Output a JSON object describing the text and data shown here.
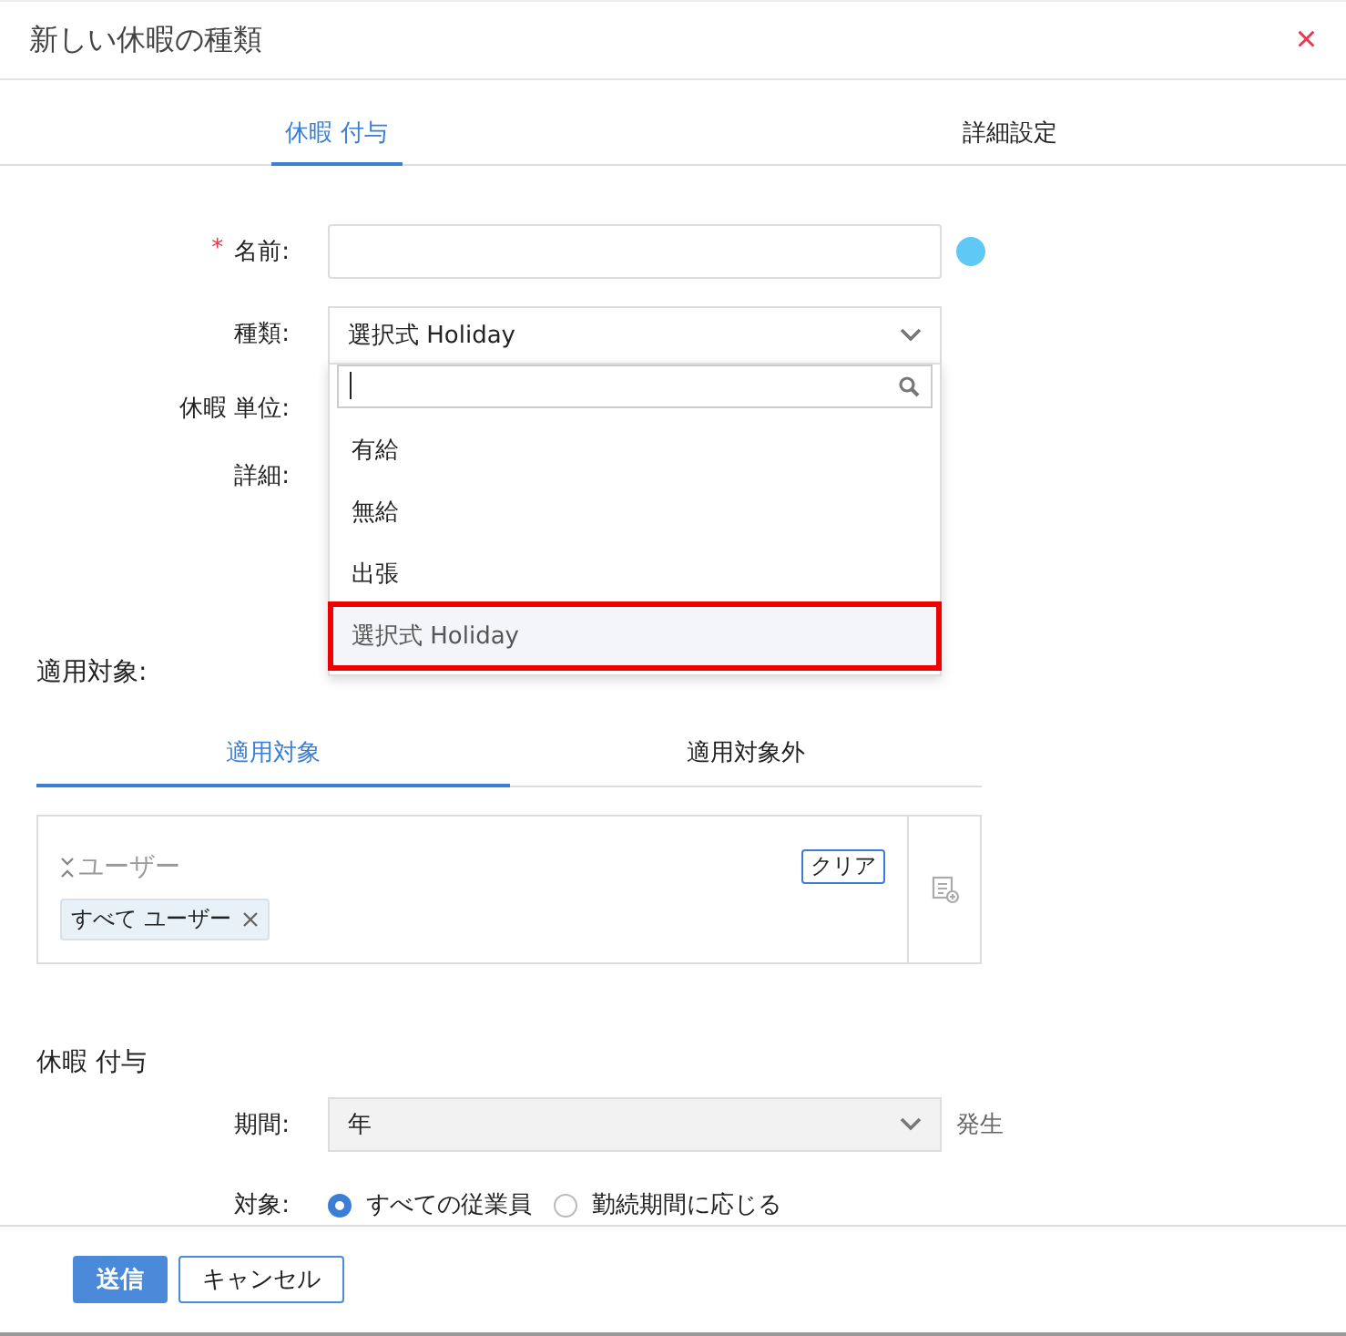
{
  "dialog": {
    "title": "新しい休暇の種類",
    "close": "×"
  },
  "tabs": [
    {
      "label": "休暇 付与",
      "selected": true
    },
    {
      "label": "詳細設定",
      "selected": false
    }
  ],
  "required_mark": "*",
  "fields": [
    {
      "kind": "text",
      "label": "名前:",
      "required": true
    },
    {
      "kind": "select",
      "label": "種類:",
      "required": false,
      "value": "選択式 Holiday",
      "expanded": true,
      "options": [
        {
          "label": "有給",
          "selected": false
        },
        {
          "label": "無給",
          "selected": false
        },
        {
          "label": "出張",
          "selected": false
        },
        {
          "label": "選択式 Holiday",
          "selected": true
        }
      ]
    },
    {
      "kind": "label",
      "label": "休暇 単位:",
      "required": false
    },
    {
      "kind": "label",
      "label": "詳細:",
      "required": false
    }
  ],
  "applies_to": {
    "heading": "適用対象:",
    "tabs": [
      {
        "label": "適用対象",
        "selected": true
      },
      {
        "label": "適用対象外",
        "selected": false
      }
    ],
    "placeholder": "ユーザー",
    "clear": "クリア",
    "chips": [
      {
        "label": "すべて ユーザー"
      }
    ]
  },
  "grant": {
    "heading": "休暇 付与",
    "period": {
      "label": "期間:",
      "value": "年",
      "suffix": "発生"
    },
    "target": {
      "label": "対象:",
      "options": [
        {
          "label": "すべての従業員",
          "selected": true
        },
        {
          "label": "勤続期間に応じる",
          "selected": false
        }
      ]
    }
  },
  "buttons": [
    {
      "label": "送信",
      "kind": "primary"
    },
    {
      "label": "キャンセル",
      "kind": "secondary"
    }
  ]
}
